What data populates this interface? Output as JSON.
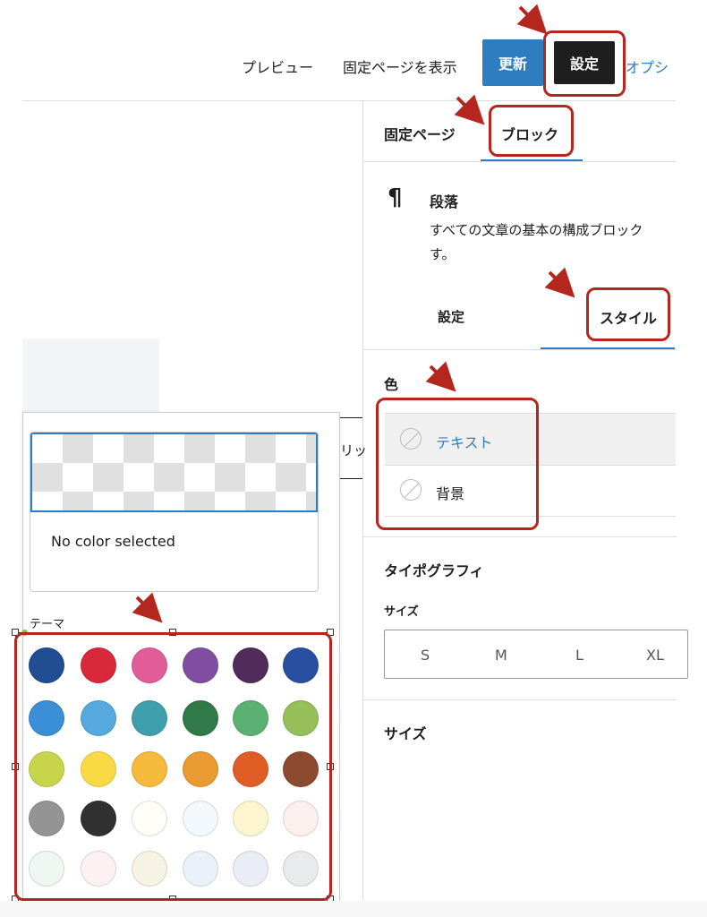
{
  "topbar": {
    "preview": "プレビュー",
    "view_page": "固定ページを表示",
    "update": "更新",
    "settings": "設定",
    "options": "オプシ"
  },
  "sidebar": {
    "tabs": [
      "固定ページ",
      "ブロック"
    ],
    "block": {
      "icon": "pilcrow-icon",
      "title": "段落",
      "description_line1": "すべての文章の基本の構成ブロック",
      "description_line2": "す。"
    },
    "subtabs": [
      "設定",
      "スタイル"
    ],
    "color": {
      "heading": "色",
      "items": [
        {
          "label": "テキスト"
        },
        {
          "label": "背景"
        }
      ]
    },
    "typography": {
      "heading": "タイポグラフィ",
      "size_label": "サイズ",
      "sizes": [
        "S",
        "M",
        "L",
        "XL"
      ]
    },
    "size_heading": "サイズ"
  },
  "editor": {
    "partial_text": "リッ"
  },
  "popover": {
    "no_color": "No color selected",
    "theme_label": "テーマ",
    "swatches": [
      "#214d92",
      "#d8283a",
      "#e05d97",
      "#7f4ea0",
      "#512b59",
      "#2750a0",
      "#3a8fd6",
      "#56a9de",
      "#3fa0ab",
      "#2f7a48",
      "#5bb073",
      "#96be59",
      "#c8d54a",
      "#f9da44",
      "#f6ba3d",
      "#e99a30",
      "#e15d26",
      "#8c4a2e",
      "#949494",
      "#303030",
      "#fffdf8",
      "#f3f8fd",
      "#fdf5d0",
      "#fbf0ed",
      "#eef7f1",
      "#fdf1f4",
      "#f6f2e4",
      "#eaf1fa",
      "#eaedf6",
      "#e8eaec"
    ]
  },
  "colors": {
    "accent": "#2f7dc1",
    "dark": "#1e1e1e",
    "annotation": "#b5261e"
  }
}
